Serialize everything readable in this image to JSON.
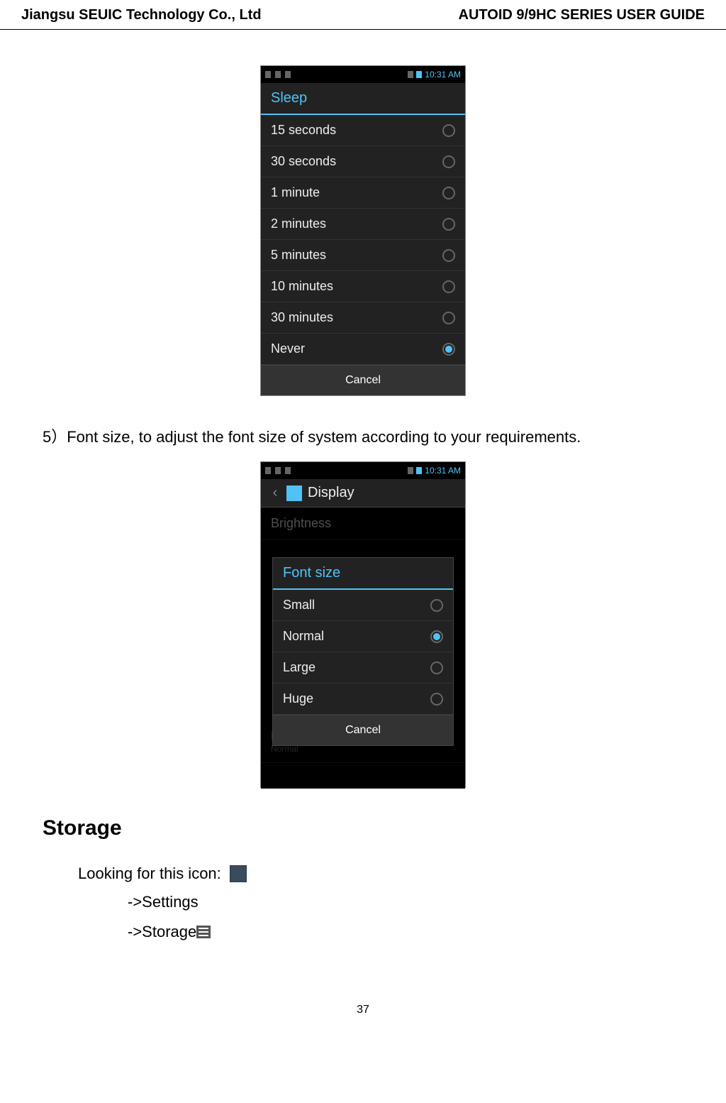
{
  "header": {
    "left": "Jiangsu SEUIC Technology Co., Ltd",
    "right": "AUTOID 9/9HC SERIES USER GUIDE"
  },
  "screenshot1": {
    "status_time": "10:31 AM",
    "dialog_title": "Sleep",
    "options": [
      {
        "label": "15 seconds",
        "selected": false
      },
      {
        "label": "30 seconds",
        "selected": false
      },
      {
        "label": "1 minute",
        "selected": false
      },
      {
        "label": "2 minutes",
        "selected": false
      },
      {
        "label": "5 minutes",
        "selected": false
      },
      {
        "label": "10 minutes",
        "selected": false
      },
      {
        "label": "30 minutes",
        "selected": false
      },
      {
        "label": "Never",
        "selected": true
      }
    ],
    "cancel_label": "Cancel"
  },
  "body_text_5": "5）Font size, to adjust the font size of system according to your requirements.",
  "screenshot2": {
    "status_time": "10:31 AM",
    "title": "Display",
    "bg_item_brightness": "Brightness",
    "bg_item_fontsize": "Font size",
    "bg_item_fontsize_sub": "Normal",
    "dialog_title": "Font size",
    "options": [
      {
        "label": "Small",
        "selected": false
      },
      {
        "label": "Normal",
        "selected": true
      },
      {
        "label": "Large",
        "selected": false
      },
      {
        "label": "Huge",
        "selected": false
      }
    ],
    "cancel_label": "Cancel"
  },
  "storage": {
    "heading": "Storage",
    "looking": "Looking for this icon:",
    "step1": "->Settings",
    "step2": "->Storage"
  },
  "page_number": "37"
}
